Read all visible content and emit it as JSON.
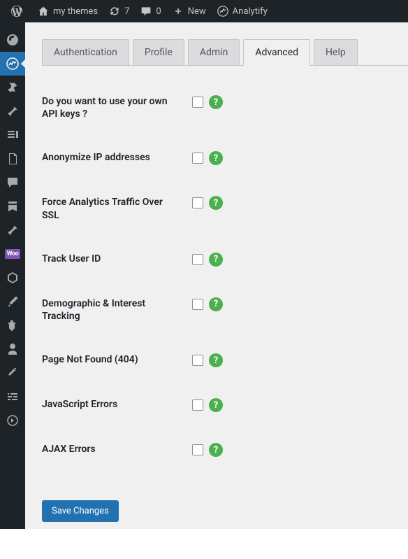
{
  "adminbar": {
    "site_name": "my themes",
    "updates": "7",
    "comments": "0",
    "new": "New",
    "analytify": "Analytify"
  },
  "tabs": [
    {
      "label": "Authentication",
      "active": false
    },
    {
      "label": "Profile",
      "active": false
    },
    {
      "label": "Admin",
      "active": false
    },
    {
      "label": "Advanced",
      "active": true
    },
    {
      "label": "Help",
      "active": false
    }
  ],
  "settings": [
    {
      "label": "Do you want to use your own API keys ?",
      "checked": false
    },
    {
      "label": "Anonymize IP addresses",
      "checked": false
    },
    {
      "label": "Force Analytics Traffic Over SSL",
      "checked": false
    },
    {
      "label": "Track User ID",
      "checked": false
    },
    {
      "label": "Demographic & Interest Tracking",
      "checked": false
    },
    {
      "label": "Page Not Found (404)",
      "checked": false
    },
    {
      "label": "JavaScript Errors",
      "checked": false
    },
    {
      "label": "AJAX Errors",
      "checked": false
    }
  ],
  "buttons": {
    "save": "Save Changes"
  }
}
